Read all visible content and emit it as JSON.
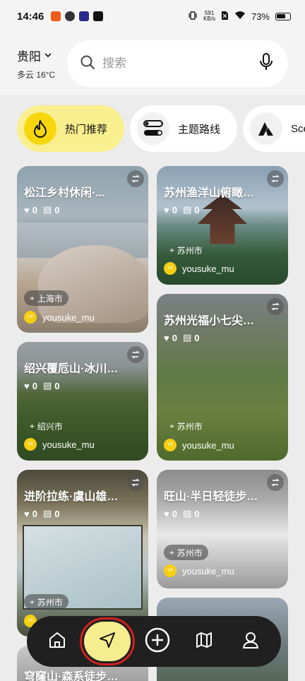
{
  "status": {
    "time": "14:46",
    "net_speed_value": "591",
    "net_speed_unit": "KB/s",
    "battery": "73%"
  },
  "header": {
    "city": "贵阳",
    "weather": "多云 16°C",
    "search_placeholder": "搜索"
  },
  "tabs": [
    {
      "label": "热门推荐",
      "icon": "flame-icon"
    },
    {
      "label": "主题路线",
      "icon": "toggles-icon"
    },
    {
      "label": "Sce",
      "icon": "mountain-icon"
    }
  ],
  "cards": [
    {
      "title": "松江乡村休闲·...",
      "likes": "0",
      "comments": "0",
      "city": "上海市",
      "author": "yousuke_mu"
    },
    {
      "title": "苏州渔洋山俯瞰…",
      "likes": "0",
      "comments": "0",
      "city": "苏州市",
      "author": "yousuke_mu"
    },
    {
      "title": "苏州光福小七尖…",
      "likes": "0",
      "comments": "0",
      "city": "",
      "author": ""
    },
    {
      "title": "绍兴覆卮山·冰川…",
      "likes": "0",
      "comments": "0",
      "city": "绍兴市",
      "author": "yousuke_mu"
    },
    {
      "title": "",
      "likes": "",
      "comments": "",
      "city": "苏州市",
      "author": "yousuke_mu"
    },
    {
      "title": "进阶拉练·虞山雄…",
      "likes": "0",
      "comments": "0",
      "city": "苏州市",
      "author": ""
    },
    {
      "title": "旺山·半日轻徒步…",
      "likes": "0",
      "comments": "0",
      "city": "苏州市",
      "author": "yousuke_mu"
    },
    {
      "title": "穹窿山·森系徒步…",
      "likes": "",
      "comments": "",
      "city": "",
      "author": ""
    }
  ],
  "avatar_text": "VII",
  "nav": {
    "items": [
      "home-icon",
      "navigate-icon",
      "add-icon",
      "map-icon",
      "profile-icon"
    ]
  },
  "colors": {
    "accent_yellow": "#f6d70d",
    "light_yellow": "#f9ef8e",
    "nav_dark": "#202020",
    "highlight_red": "#d12020"
  }
}
